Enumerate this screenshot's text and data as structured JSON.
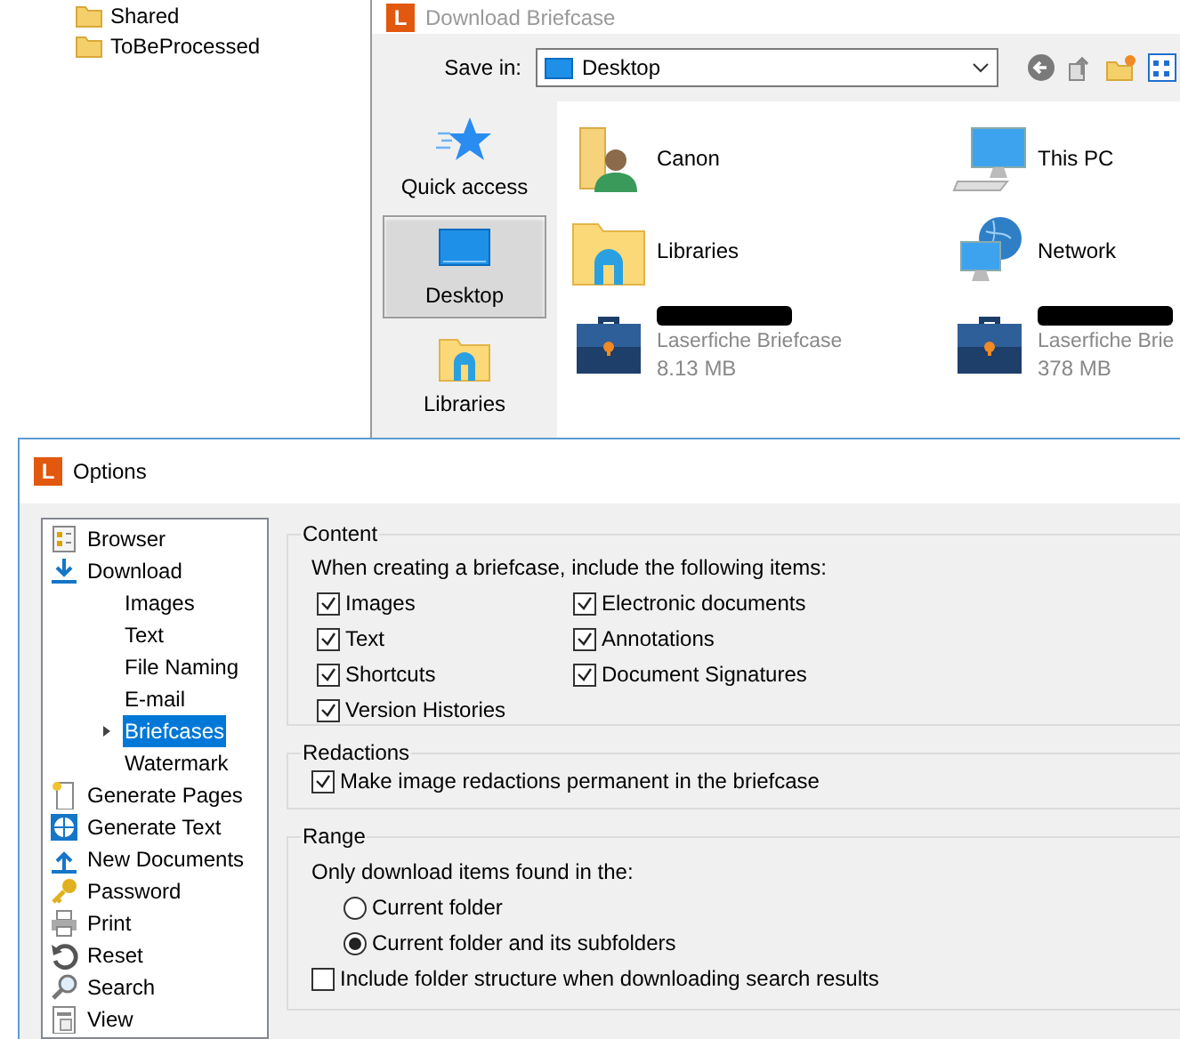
{
  "explorer_tree": [
    {
      "label": "Shared"
    },
    {
      "label": "ToBeProcessed"
    }
  ],
  "download_dialog": {
    "logo": "L",
    "title": "Download Briefcase",
    "save_in_label": "Save in:",
    "save_in_value": "Desktop",
    "places": [
      {
        "label": "Quick access",
        "kind": "star",
        "selected": false
      },
      {
        "label": "Desktop",
        "kind": "desktop",
        "selected": true
      },
      {
        "label": "Libraries",
        "kind": "libraries",
        "selected": false
      }
    ],
    "files": [
      {
        "kind": "user-folder",
        "name": "Canon"
      },
      {
        "kind": "computer",
        "name": "This PC"
      },
      {
        "kind": "libraries",
        "name": "Libraries"
      },
      {
        "kind": "network",
        "name": "Network"
      },
      {
        "kind": "briefcase",
        "redacted": true,
        "type": "Laserfiche Briefcase",
        "size": "8.13 MB"
      },
      {
        "kind": "briefcase",
        "redacted": true,
        "type": "Laserfiche Brie",
        "size": "378 MB"
      }
    ]
  },
  "options": {
    "logo": "L",
    "title": "Options",
    "tree": [
      {
        "label": "Browser",
        "kind": "browser",
        "selected": false
      },
      {
        "label": "Download",
        "kind": "download",
        "selected": false,
        "children": [
          {
            "label": "Images",
            "selected": false
          },
          {
            "label": "Text",
            "selected": false
          },
          {
            "label": "File Naming",
            "selected": false
          },
          {
            "label": "E-mail",
            "selected": false
          },
          {
            "label": "Briefcases",
            "selected": true,
            "expanded": false
          },
          {
            "label": "Watermark",
            "selected": false
          }
        ]
      },
      {
        "label": "Generate Pages",
        "kind": "page-sparkle",
        "selected": false
      },
      {
        "label": "Generate Text",
        "kind": "ocr",
        "selected": false
      },
      {
        "label": "New Documents",
        "kind": "upload",
        "selected": false
      },
      {
        "label": "Password",
        "kind": "key",
        "selected": false
      },
      {
        "label": "Print",
        "kind": "printer",
        "selected": false
      },
      {
        "label": "Reset",
        "kind": "reset",
        "selected": false
      },
      {
        "label": "Search",
        "kind": "search",
        "selected": false
      },
      {
        "label": "View",
        "kind": "page",
        "selected": false
      }
    ],
    "content": {
      "title": "Content",
      "intro": "When creating a briefcase, include the following items:",
      "columns": [
        [
          {
            "label": "Images",
            "checked": true
          },
          {
            "label": "Text",
            "checked": true
          },
          {
            "label": "Shortcuts",
            "checked": true
          },
          {
            "label": "Version Histories",
            "checked": true
          }
        ],
        [
          {
            "label": "Electronic documents",
            "checked": true
          },
          {
            "label": "Annotations",
            "checked": true
          },
          {
            "label": "Document Signatures",
            "checked": true
          }
        ]
      ]
    },
    "redactions": {
      "title": "Redactions",
      "option": {
        "label": "Make image redactions permanent in the briefcase",
        "checked": true
      }
    },
    "range": {
      "title": "Range",
      "intro": "Only download items found in the:",
      "choices": [
        {
          "label": "Current folder",
          "selected": false
        },
        {
          "label": "Current folder and its subfolders",
          "selected": true
        }
      ],
      "option": {
        "label": "Include folder structure when downloading search results",
        "checked": false
      }
    }
  }
}
